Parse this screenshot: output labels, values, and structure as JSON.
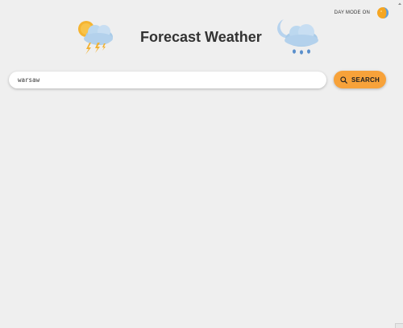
{
  "mode_toggle": {
    "label": "DAY MODE ON",
    "icon": "sun-moon-icon"
  },
  "header": {
    "title": "Forecast Weather",
    "left_icon": "sun-cloud-thunder-icon",
    "right_icon": "moon-cloud-rain-icon"
  },
  "search": {
    "value": "warsaw",
    "placeholder": "",
    "button_label": "SEARCH",
    "button_icon": "search-icon"
  },
  "colors": {
    "background": "#efefef",
    "accent": "#f7a23a",
    "text": "#333333",
    "input_background": "#ffffff"
  }
}
